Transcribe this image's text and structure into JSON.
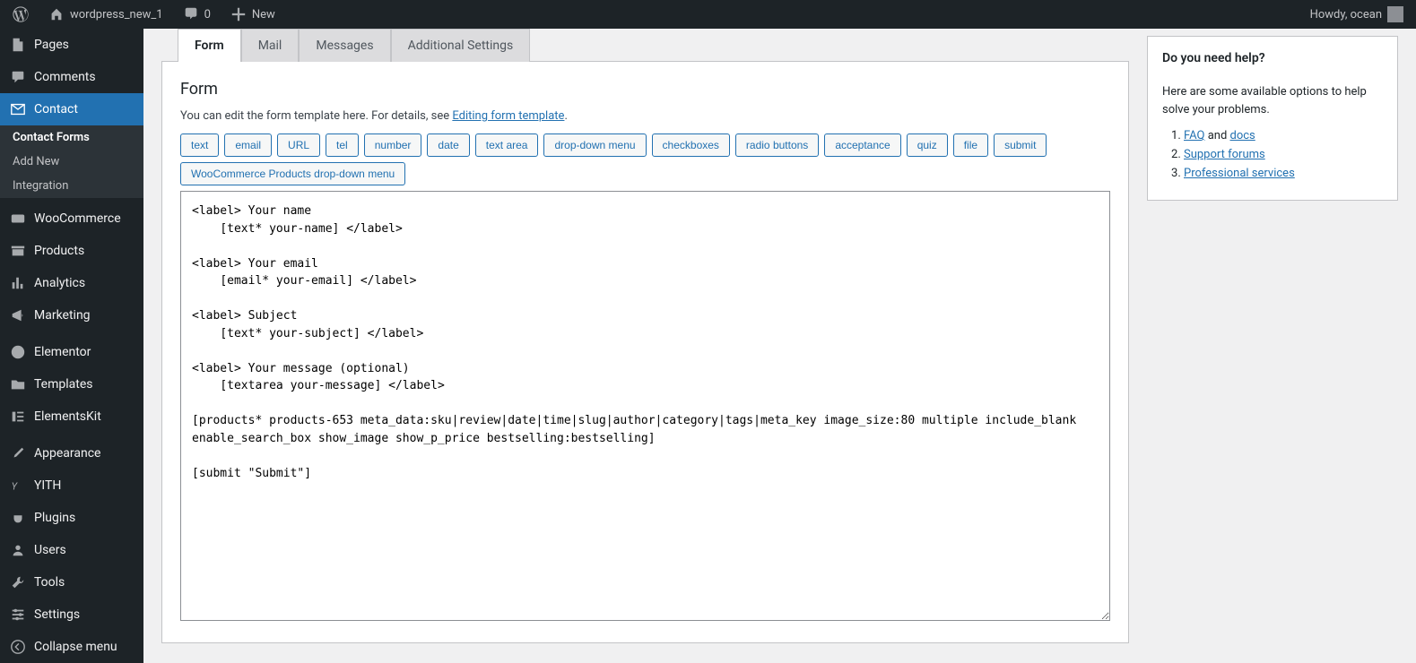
{
  "adminbar": {
    "site_name": "wordpress_new_1",
    "comments_count": "0",
    "new_label": "New",
    "greeting": "Howdy, ocean"
  },
  "sidebar": {
    "pages": "Pages",
    "comments": "Comments",
    "contact": "Contact",
    "contact_sub": {
      "forms": "Contact Forms",
      "add_new": "Add New",
      "integration": "Integration"
    },
    "woocommerce": "WooCommerce",
    "products": "Products",
    "analytics": "Analytics",
    "marketing": "Marketing",
    "elementor": "Elementor",
    "templates": "Templates",
    "elementskit": "ElementsKit",
    "appearance": "Appearance",
    "yith": "YITH",
    "plugins": "Plugins",
    "users": "Users",
    "tools": "Tools",
    "settings": "Settings",
    "collapse": "Collapse menu"
  },
  "tabs": {
    "form": "Form",
    "mail": "Mail",
    "messages": "Messages",
    "additional": "Additional Settings"
  },
  "form_panel": {
    "heading": "Form",
    "intro_prefix": "You can edit the form template here. For details, see ",
    "intro_link": "Editing form template",
    "tags": [
      "text",
      "email",
      "URL",
      "tel",
      "number",
      "date",
      "text area",
      "drop-down menu",
      "checkboxes",
      "radio buttons",
      "acceptance",
      "quiz",
      "file",
      "submit",
      "WooCommerce Products drop-down menu"
    ],
    "textarea_value": "<label> Your name\n    [text* your-name] </label>\n\n<label> Your email\n    [email* your-email] </label>\n\n<label> Subject\n    [text* your-subject] </label>\n\n<label> Your message (optional)\n    [textarea your-message] </label>\n\n[products* products-653 meta_data:sku|review|date|time|slug|author|category|tags|meta_key image_size:80 multiple include_blank enable_search_box show_image show_p_price bestselling:bestselling]\n\n[submit \"Submit\"]"
  },
  "help": {
    "title": "Do you need help?",
    "blurb": "Here are some available options to help solve your problems.",
    "faq": "FAQ",
    "and": " and ",
    "docs": "docs",
    "support": "Support forums",
    "pro": "Professional services"
  }
}
